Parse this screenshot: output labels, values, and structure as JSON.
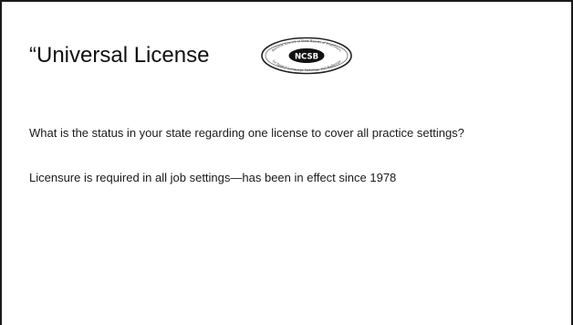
{
  "slide": {
    "title": "“Universal License",
    "paragraphs": [
      "What is the status in your state regarding one license to cover all practice settings?",
      "Licensure is required in all job settings—has been in effect since 1978"
    ],
    "logo": {
      "center_text": "NCSB",
      "top_arc_text": "National Council of State Boards of Examiners",
      "bottom_arc_text": "for Speech-Language Pathology and Audiology"
    }
  }
}
